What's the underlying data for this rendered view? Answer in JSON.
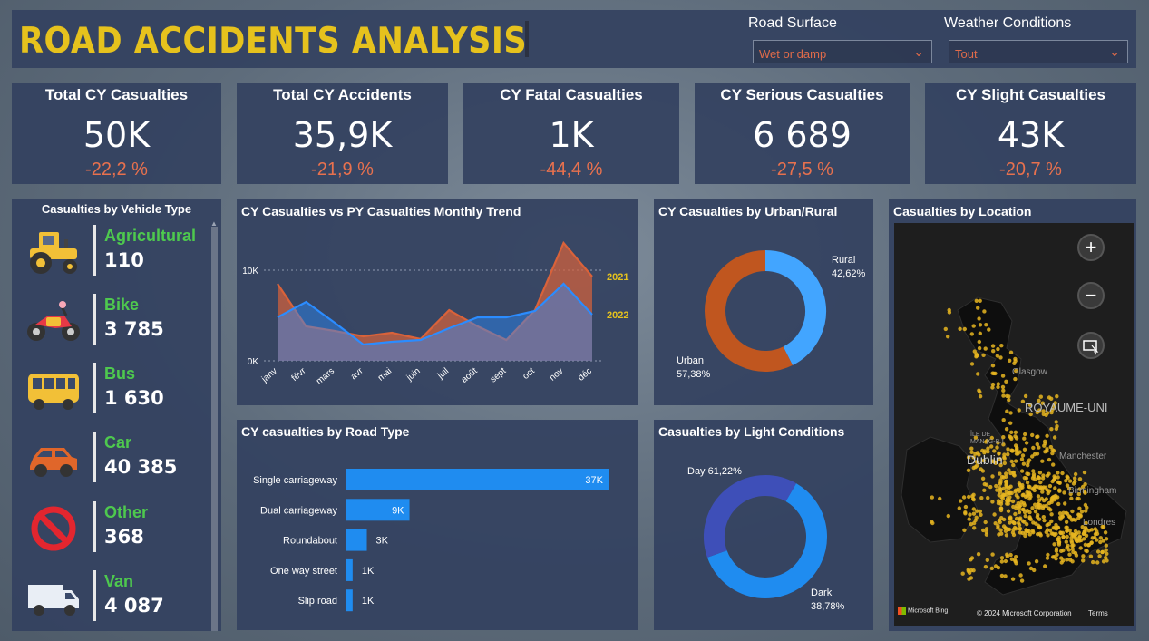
{
  "header": {
    "title": "ROAD ACCIDENTS ANALYSIS",
    "filters": [
      {
        "label": "Road Surface",
        "value": "Wet or damp"
      },
      {
        "label": "Weather Conditions",
        "value": "Tout"
      }
    ]
  },
  "kpis": [
    {
      "title": "Total CY Casualties",
      "value": "50K",
      "change": "-22,2 %"
    },
    {
      "title": "Total CY Accidents",
      "value": "35,9K",
      "change": "-21,9 %"
    },
    {
      "title": "CY Fatal Casualties",
      "value": "1K",
      "change": "-44,4 %"
    },
    {
      "title": "CY Serious Casualties",
      "value": "6 689",
      "change": "-27,5 %"
    },
    {
      "title": "CY Slight Casualties",
      "value": "43K",
      "change": "-20,7 %"
    }
  ],
  "vehicles": {
    "title": "Casualties by Vehicle Type",
    "items": [
      {
        "label": "Agricultural",
        "value": "110",
        "icon": "tractor-icon"
      },
      {
        "label": "Bike",
        "value": "3 785",
        "icon": "motorbike-icon"
      },
      {
        "label": "Bus",
        "value": "1 630",
        "icon": "bus-icon"
      },
      {
        "label": "Car",
        "value": "40 385",
        "icon": "car-icon"
      },
      {
        "label": "Other",
        "value": "368",
        "icon": "prohibited-icon"
      },
      {
        "label": "Van",
        "value": "4 087",
        "icon": "van-icon"
      }
    ],
    "label_color": "#4ec94e"
  },
  "trend": {
    "title": "CY Casualties vs PY Casualties Monthly Trend",
    "chart_data": {
      "type": "area",
      "categories": [
        "janv",
        "févr",
        "mars",
        "avr",
        "mai",
        "juin",
        "juil",
        "août",
        "sept",
        "oct",
        "nov",
        "déc"
      ],
      "series": [
        {
          "name": "2021",
          "values": [
            8500,
            3800,
            3300,
            2700,
            3100,
            2400,
            5600,
            3800,
            2300,
            5600,
            13000,
            9300
          ],
          "color": "#d9623a"
        },
        {
          "name": "2022",
          "values": [
            4800,
            6500,
            4200,
            1800,
            2100,
            2300,
            3600,
            4800,
            4800,
            5500,
            8500,
            5100
          ],
          "color": "#2b8cff"
        }
      ],
      "y_ticks": [
        "0K",
        "10K"
      ],
      "ylim": [
        0,
        14000
      ]
    }
  },
  "urban": {
    "title": "CY Casualties by Urban/Rural",
    "chart_data": {
      "type": "pie",
      "slices": [
        {
          "label": "Rural",
          "pct_label": "42,62%",
          "value": 42.62,
          "color": "#42a5ff"
        },
        {
          "label": "Urban",
          "pct_label": "57,38%",
          "value": 57.38,
          "color": "#c0561f"
        }
      ]
    }
  },
  "road": {
    "title": "CY casualties by Road Type",
    "chart_data": {
      "type": "bar",
      "categories": [
        "Single carriageway",
        "Dual carriageway",
        "Roundabout",
        "One way street",
        "Slip road"
      ],
      "values": [
        37000,
        9000,
        3000,
        1000,
        1000
      ],
      "labels": [
        "37K",
        "9K",
        "3K",
        "1K",
        "1K"
      ],
      "color": "#1f8cf0"
    }
  },
  "light": {
    "title": "Casualties by Light Conditions",
    "chart_data": {
      "type": "pie",
      "slices": [
        {
          "label": "Day",
          "pct_label": "61,22%",
          "value": 61.22,
          "color": "#1f8cf0"
        },
        {
          "label": "Dark",
          "pct_label": "38,78%",
          "value": 38.78,
          "color": "#3e4fb8"
        }
      ]
    }
  },
  "map": {
    "title": "Casualties by Location",
    "place_labels": [
      "ROYAUME-UNI",
      "Dublin",
      "Glasgow",
      "Manchester",
      "ÎLE DE MAN (G-B.)",
      "Birmingham",
      "Londres"
    ],
    "copyright": "© 2024 Microsoft Corporation",
    "terms": "Terms",
    "brand": "Microsoft Bing",
    "dot_color": "#e6b520"
  }
}
